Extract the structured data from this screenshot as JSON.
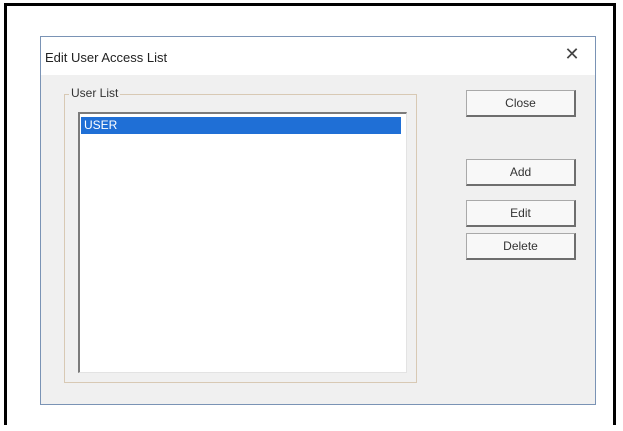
{
  "dialog": {
    "title": "Edit User Access List",
    "close_glyph": "✕"
  },
  "group": {
    "label": "User List"
  },
  "list": {
    "items": [
      "USER"
    ],
    "selected_index": 0
  },
  "buttons": {
    "close": "Close",
    "add": "Add",
    "edit": "Edit",
    "delete": "Delete"
  },
  "colors": {
    "selection": "#1f6fd6",
    "dialog_bg": "#f0f0f0",
    "dialog_border": "#7a93b5"
  },
  "icons": {
    "close": "close-icon"
  }
}
